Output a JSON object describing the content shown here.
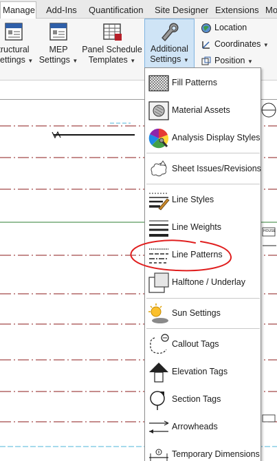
{
  "tabs": [
    {
      "label": "Manage",
      "active": true
    },
    {
      "label": "Add-Ins",
      "active": false
    },
    {
      "label": "Quantification",
      "active": false
    },
    {
      "label": "Site Designer",
      "active": false
    },
    {
      "label": "Extensions",
      "active": false
    },
    {
      "label": "Mo",
      "active": false
    }
  ],
  "ribbon": {
    "structural_settings": {
      "line1": "tructural",
      "line2": "Settings"
    },
    "mep_settings": {
      "line1": "MEP",
      "line2": "Settings"
    },
    "panel_schedule": {
      "line1": "Panel Schedule",
      "line2": "Templates"
    },
    "additional_settings": {
      "line1": "Additional",
      "line2": "Settings"
    },
    "location": "Location",
    "coordinates": "Coordinates",
    "position": "Position"
  },
  "menu": {
    "items": [
      {
        "label": "Fill Patterns",
        "icon": "fill-patterns-icon"
      },
      {
        "label": "Material Assets",
        "icon": "material-assets-icon"
      },
      {
        "label": "Analysis Display Styles",
        "icon": "analysis-display-styles-icon"
      },
      {
        "label": "Sheet Issues/Revisions",
        "icon": "sheet-issues-icon"
      },
      {
        "label": "Line Styles",
        "icon": "line-styles-icon"
      },
      {
        "label": "Line Weights",
        "icon": "line-weights-icon"
      },
      {
        "label": "Line Patterns",
        "icon": "line-patterns-icon",
        "highlighted": true
      },
      {
        "label": "Halftone / Underlay",
        "icon": "halftone-underlay-icon"
      },
      {
        "label": "Sun Settings",
        "icon": "sun-settings-icon"
      },
      {
        "label": "Callout Tags",
        "icon": "callout-tags-icon"
      },
      {
        "label": "Elevation Tags",
        "icon": "elevation-tags-icon"
      },
      {
        "label": "Section Tags",
        "icon": "section-tags-icon"
      },
      {
        "label": "Arrowheads",
        "icon": "arrowheads-icon"
      },
      {
        "label": "Temporary Dimensions",
        "icon": "temporary-dimensions-icon"
      }
    ]
  },
  "canvas": {
    "tag_text": "HOUSE",
    "colors": {
      "gridline": "#8b1a1a",
      "greenline": "#2e7d32",
      "cyan": "#4db6d8",
      "annotation": "#e01e1e",
      "selected_bg": "#cfe4f6"
    }
  }
}
